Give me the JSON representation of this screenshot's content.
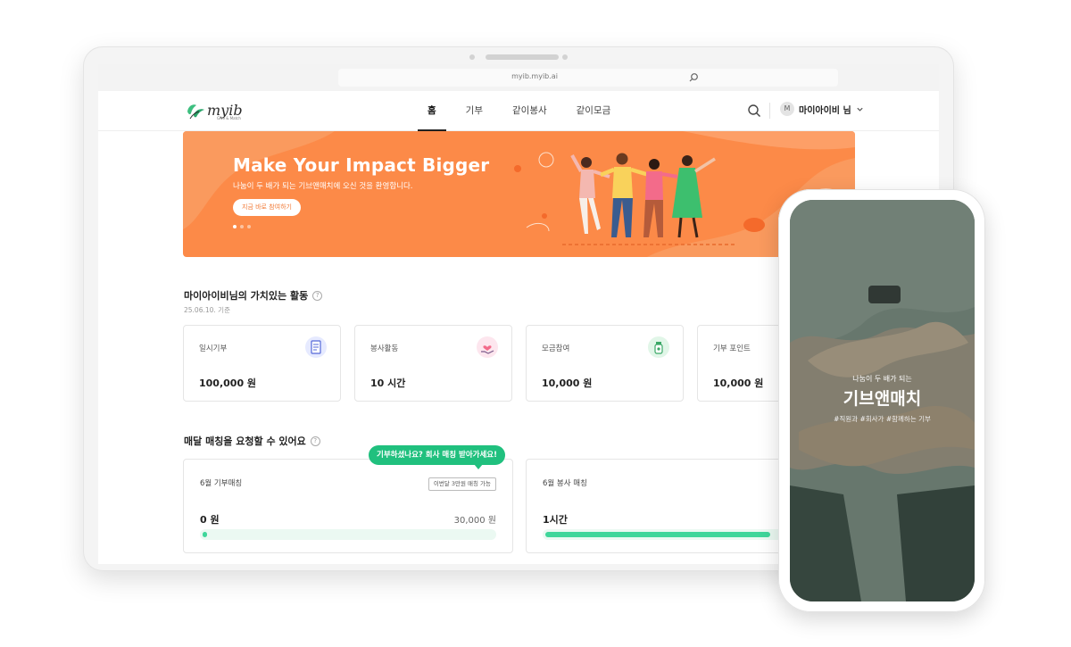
{
  "browser": {
    "url": "myib.myib.ai"
  },
  "nav": {
    "logo_text": "myib",
    "logo_sub": "Give & Match",
    "menu": [
      {
        "label": "홈",
        "active": true
      },
      {
        "label": "기부",
        "active": false
      },
      {
        "label": "같이봉사",
        "active": false
      },
      {
        "label": "같이모금",
        "active": false
      }
    ],
    "user": {
      "avatar_letter": "M",
      "name": "마이아이비 님"
    }
  },
  "hero": {
    "title": "Make Your Impact Bigger",
    "subtitle": "나눔이 두 배가 되는 기브앤매치에 오신 것을 환영합니다.",
    "cta": "지금 바로 참여하기"
  },
  "activity": {
    "title": "마이아이비님의 가치있는 활동",
    "date": "25.06.10. 기준",
    "stats": [
      {
        "label": "일시기부",
        "value": "100,000 원",
        "icon": "receipt-icon",
        "color": "#e6eaff"
      },
      {
        "label": "봉사활동",
        "value": "10 시간",
        "icon": "heart-hand-icon",
        "color": "#fde6ee"
      },
      {
        "label": "모금참여",
        "value": "10,000 원",
        "icon": "donation-jar-icon",
        "color": "#e1f6e8"
      },
      {
        "label": "기부 포인트",
        "value": "10,000 원",
        "icon": "",
        "color": ""
      }
    ]
  },
  "matching": {
    "title": "매달 매칭을 요청할 수 있어요",
    "tooltip": "기부하셨나요? 회사 매칭 받아가세요!",
    "cards": [
      {
        "title": "6월 기부매칭",
        "badge": "이번달 3만원 매칭 가능",
        "value": "0 원",
        "target": "30,000 원",
        "progress": 0.01
      },
      {
        "title": "6월 봉사 매칭",
        "value": "1시간",
        "progress": 0.6
      }
    ]
  },
  "phone": {
    "subtitle": "나눔이 두 배가 되는",
    "title": "기브앤매치",
    "tags": "#직원과 #회사가 #함께하는 기부"
  },
  "colors": {
    "accent_green": "#20c07e",
    "hero_orange": "#fc8a48",
    "progress_green": "#3fd69a"
  }
}
